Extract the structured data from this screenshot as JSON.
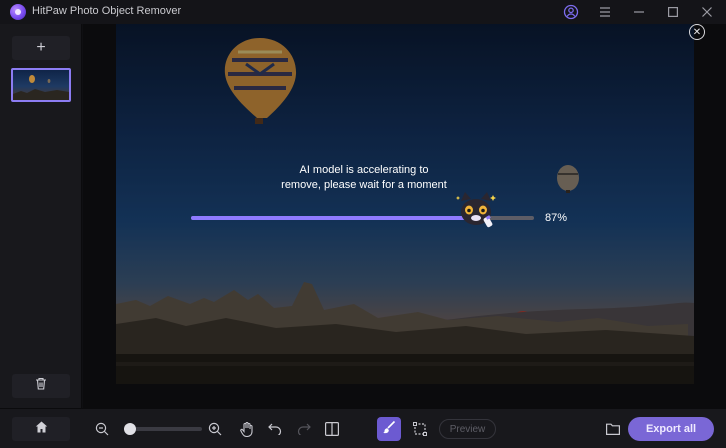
{
  "app": {
    "title": "HitPaw Photo Object Remover"
  },
  "sidebar": {
    "add_label": "+"
  },
  "overlay": {
    "message_line1": "AI model is accelerating to",
    "message_line2": "remove, please wait for a moment",
    "progress_percent": 87,
    "progress_label": "87%"
  },
  "toolbar": {
    "preview_label": "Preview",
    "export_label": "Export all"
  },
  "colors": {
    "accent": "#7a67d6",
    "progress": "#8f7bff"
  }
}
